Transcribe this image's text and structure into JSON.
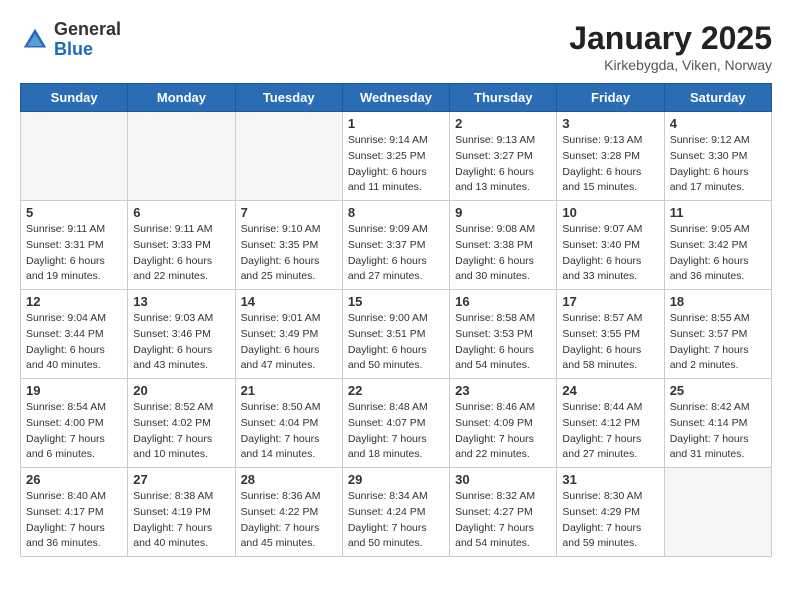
{
  "header": {
    "logo_general": "General",
    "logo_blue": "Blue",
    "title": "January 2025",
    "subtitle": "Kirkebygda, Viken, Norway"
  },
  "weekdays": [
    "Sunday",
    "Monday",
    "Tuesday",
    "Wednesday",
    "Thursday",
    "Friday",
    "Saturday"
  ],
  "weeks": [
    [
      {
        "day": "",
        "info": ""
      },
      {
        "day": "",
        "info": ""
      },
      {
        "day": "",
        "info": ""
      },
      {
        "day": "1",
        "info": "Sunrise: 9:14 AM\nSunset: 3:25 PM\nDaylight: 6 hours\nand 11 minutes."
      },
      {
        "day": "2",
        "info": "Sunrise: 9:13 AM\nSunset: 3:27 PM\nDaylight: 6 hours\nand 13 minutes."
      },
      {
        "day": "3",
        "info": "Sunrise: 9:13 AM\nSunset: 3:28 PM\nDaylight: 6 hours\nand 15 minutes."
      },
      {
        "day": "4",
        "info": "Sunrise: 9:12 AM\nSunset: 3:30 PM\nDaylight: 6 hours\nand 17 minutes."
      }
    ],
    [
      {
        "day": "5",
        "info": "Sunrise: 9:11 AM\nSunset: 3:31 PM\nDaylight: 6 hours\nand 19 minutes."
      },
      {
        "day": "6",
        "info": "Sunrise: 9:11 AM\nSunset: 3:33 PM\nDaylight: 6 hours\nand 22 minutes."
      },
      {
        "day": "7",
        "info": "Sunrise: 9:10 AM\nSunset: 3:35 PM\nDaylight: 6 hours\nand 25 minutes."
      },
      {
        "day": "8",
        "info": "Sunrise: 9:09 AM\nSunset: 3:37 PM\nDaylight: 6 hours\nand 27 minutes."
      },
      {
        "day": "9",
        "info": "Sunrise: 9:08 AM\nSunset: 3:38 PM\nDaylight: 6 hours\nand 30 minutes."
      },
      {
        "day": "10",
        "info": "Sunrise: 9:07 AM\nSunset: 3:40 PM\nDaylight: 6 hours\nand 33 minutes."
      },
      {
        "day": "11",
        "info": "Sunrise: 9:05 AM\nSunset: 3:42 PM\nDaylight: 6 hours\nand 36 minutes."
      }
    ],
    [
      {
        "day": "12",
        "info": "Sunrise: 9:04 AM\nSunset: 3:44 PM\nDaylight: 6 hours\nand 40 minutes."
      },
      {
        "day": "13",
        "info": "Sunrise: 9:03 AM\nSunset: 3:46 PM\nDaylight: 6 hours\nand 43 minutes."
      },
      {
        "day": "14",
        "info": "Sunrise: 9:01 AM\nSunset: 3:49 PM\nDaylight: 6 hours\nand 47 minutes."
      },
      {
        "day": "15",
        "info": "Sunrise: 9:00 AM\nSunset: 3:51 PM\nDaylight: 6 hours\nand 50 minutes."
      },
      {
        "day": "16",
        "info": "Sunrise: 8:58 AM\nSunset: 3:53 PM\nDaylight: 6 hours\nand 54 minutes."
      },
      {
        "day": "17",
        "info": "Sunrise: 8:57 AM\nSunset: 3:55 PM\nDaylight: 6 hours\nand 58 minutes."
      },
      {
        "day": "18",
        "info": "Sunrise: 8:55 AM\nSunset: 3:57 PM\nDaylight: 7 hours\nand 2 minutes."
      }
    ],
    [
      {
        "day": "19",
        "info": "Sunrise: 8:54 AM\nSunset: 4:00 PM\nDaylight: 7 hours\nand 6 minutes."
      },
      {
        "day": "20",
        "info": "Sunrise: 8:52 AM\nSunset: 4:02 PM\nDaylight: 7 hours\nand 10 minutes."
      },
      {
        "day": "21",
        "info": "Sunrise: 8:50 AM\nSunset: 4:04 PM\nDaylight: 7 hours\nand 14 minutes."
      },
      {
        "day": "22",
        "info": "Sunrise: 8:48 AM\nSunset: 4:07 PM\nDaylight: 7 hours\nand 18 minutes."
      },
      {
        "day": "23",
        "info": "Sunrise: 8:46 AM\nSunset: 4:09 PM\nDaylight: 7 hours\nand 22 minutes."
      },
      {
        "day": "24",
        "info": "Sunrise: 8:44 AM\nSunset: 4:12 PM\nDaylight: 7 hours\nand 27 minutes."
      },
      {
        "day": "25",
        "info": "Sunrise: 8:42 AM\nSunset: 4:14 PM\nDaylight: 7 hours\nand 31 minutes."
      }
    ],
    [
      {
        "day": "26",
        "info": "Sunrise: 8:40 AM\nSunset: 4:17 PM\nDaylight: 7 hours\nand 36 minutes."
      },
      {
        "day": "27",
        "info": "Sunrise: 8:38 AM\nSunset: 4:19 PM\nDaylight: 7 hours\nand 40 minutes."
      },
      {
        "day": "28",
        "info": "Sunrise: 8:36 AM\nSunset: 4:22 PM\nDaylight: 7 hours\nand 45 minutes."
      },
      {
        "day": "29",
        "info": "Sunrise: 8:34 AM\nSunset: 4:24 PM\nDaylight: 7 hours\nand 50 minutes."
      },
      {
        "day": "30",
        "info": "Sunrise: 8:32 AM\nSunset: 4:27 PM\nDaylight: 7 hours\nand 54 minutes."
      },
      {
        "day": "31",
        "info": "Sunrise: 8:30 AM\nSunset: 4:29 PM\nDaylight: 7 hours\nand 59 minutes."
      },
      {
        "day": "",
        "info": ""
      }
    ]
  ]
}
